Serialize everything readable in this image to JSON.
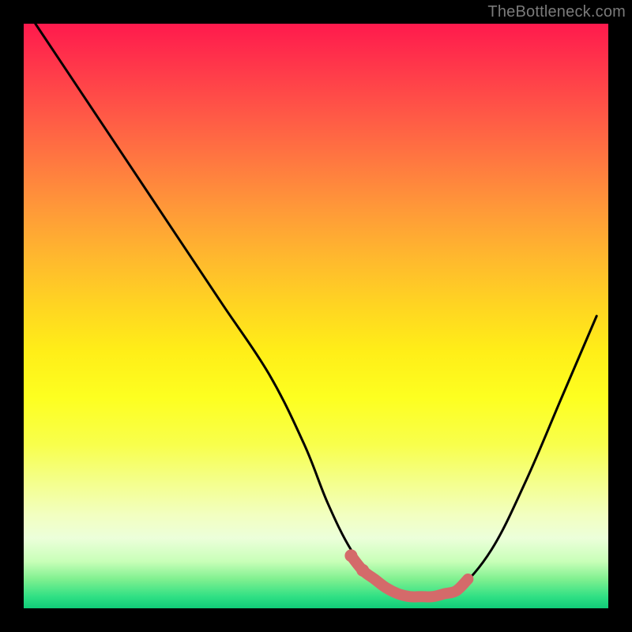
{
  "watermark": "TheBottleneck.com",
  "chart_data": {
    "type": "line",
    "title": "",
    "xlabel": "",
    "ylabel": "",
    "xlim": [
      0,
      100
    ],
    "ylim": [
      0,
      100
    ],
    "grid": false,
    "legend": false,
    "series": [
      {
        "name": "bottleneck-curve",
        "color": "#000000",
        "x": [
          2,
          10,
          18,
          26,
          34,
          42,
          48,
          52,
          56,
          60,
          63,
          66,
          70,
          74,
          80,
          86,
          92,
          98
        ],
        "y": [
          100,
          88,
          76,
          64,
          52,
          40,
          28,
          18,
          10,
          5,
          2.5,
          2,
          2,
          3,
          10,
          22,
          36,
          50
        ]
      },
      {
        "name": "optimal-zone-highlight",
        "color": "#d46a6a",
        "x": [
          56,
          58,
          60,
          62,
          64,
          66,
          68,
          70,
          72,
          74,
          76
        ],
        "y": [
          9,
          6.5,
          5,
          3.5,
          2.5,
          2,
          2,
          2,
          2.5,
          3,
          5
        ]
      }
    ],
    "highlight_dots": {
      "color": "#d46a6a",
      "points": [
        {
          "x": 56,
          "y": 9
        },
        {
          "x": 58,
          "y": 6.5
        }
      ]
    }
  },
  "colors": {
    "frame": "#000000",
    "curve": "#000000",
    "highlight": "#d46a6a",
    "gradient_top": "#ff1a4d",
    "gradient_mid": "#ffee18",
    "gradient_bottom": "#10cc78"
  }
}
